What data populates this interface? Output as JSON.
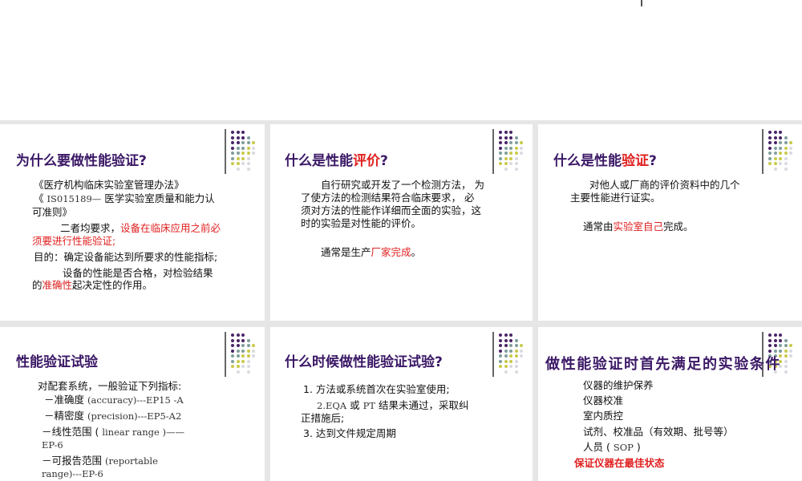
{
  "colors": {
    "title": "#3b1866",
    "accent_red": "#e02020",
    "dot_purple": "#4a2467",
    "dot_teal": "#7f9e9c",
    "dot_yellow": "#c9c94a",
    "dot_gray": "#d9d9e2"
  },
  "slides": [
    {
      "title": "为什么要做性能验证?",
      "lines": [
        {
          "a": "《医疗机构临床实验室管理办法》"
        },
        {
          "a": "《 ",
          "m": "IS015189—",
          "b": " 医学实验室质量和能力认"
        },
        {
          "a": "可准则》"
        },
        {
          "a": "二者均要求，",
          "r": "设备在临床应用之前必"
        },
        {
          "r": "须要进行性能验证;"
        },
        {
          "a": "目的：确定设备能达到所要求的性能指标;"
        },
        {
          "a": "设备的性能是否合格，对检验结果"
        },
        {
          "a": "的",
          "r": "准确性",
          "b": "起决定性的作用。"
        }
      ]
    },
    {
      "title_a": "什么是性能",
      "title_r": "评价",
      "title_b": "?",
      "lines": [
        {
          "a": "自行研究或开发了一个检测方法， 为"
        },
        {
          "a": "了使方法的检测结果符合临床要求， 必"
        },
        {
          "a": "须对方法的性能作详细而全面的实验，这"
        },
        {
          "a": "时的实验是对性能的评价。"
        },
        {
          "a": "通常是生产",
          "r": "厂家完成",
          "b": "。"
        }
      ]
    },
    {
      "title_a": "什么是性能",
      "title_r": "验证",
      "title_b": "?",
      "lines": [
        {
          "a": "对他人或厂商的评价资料中的几个"
        },
        {
          "a": "主要性能进行证实。"
        },
        {
          "a": "通常由",
          "r": "实验室自己",
          "b": "完成。"
        }
      ]
    },
    {
      "title": "性能验证试验",
      "lines": [
        {
          "a": "对配套系统，一般验证下列指标:"
        },
        {
          "a": "－准确度 ",
          "m": "(accuracy)---EP15 -A"
        },
        {
          "a": "－精密度 ",
          "m": "(precision)---EP5-A2"
        },
        {
          "a": "－线性范围 ( ",
          "m": "linear range )——"
        },
        {
          "m": "EP-6"
        },
        {
          "a": "－可报告范围 ",
          "m": "(reportable"
        },
        {
          "m": "range)---EP-6"
        }
      ]
    },
    {
      "title": "什么时候做性能验证试验?",
      "lines": [
        {
          "a": "1. 方法或系统首次在实验室使用;"
        },
        {
          "m": "2.EQA",
          "a": " 或 ",
          "m2": "PT",
          "b": " 结果未通过，采取纠"
        },
        {
          "a": "正措施后;"
        },
        {
          "a": "3. 达到文件规定周期"
        }
      ]
    },
    {
      "title": "做性能验证时首先满足的实验条件",
      "lines": [
        {
          "a": "仪器的维护保养"
        },
        {
          "a": "仪器校准"
        },
        {
          "a": "室内质控"
        },
        {
          "a": "试剂、校准品（有效期、批号等）"
        },
        {
          "a": "人员 ( ",
          "m": "SOP",
          "b": " )"
        },
        {
          "r": "保证仪器在最佳状态"
        }
      ]
    }
  ]
}
